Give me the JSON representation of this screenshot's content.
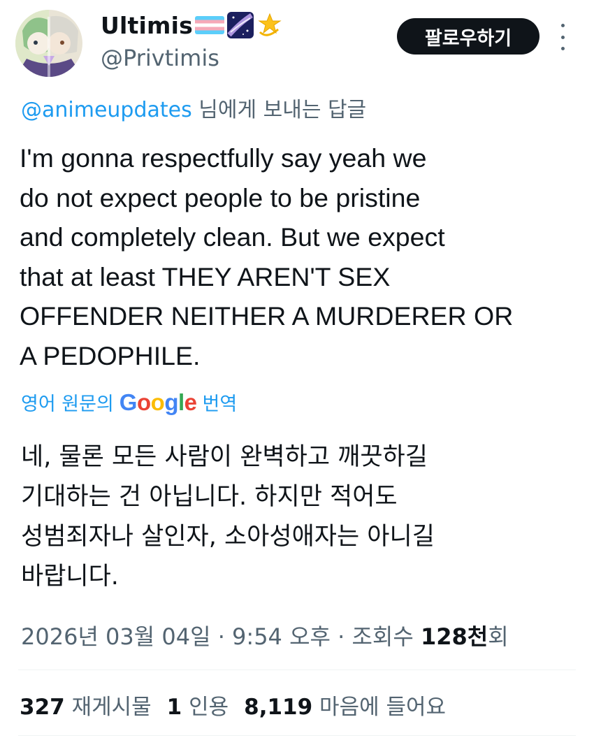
{
  "author": {
    "display_name": "Ultimis",
    "handle": "@Privtimis",
    "badges": [
      "transgender-flag-icon",
      "milky-way-icon",
      "dizzy-star-icon"
    ]
  },
  "follow_label": "팔로우하기",
  "more_icon": "more-vertical-icon",
  "reply_to": {
    "mention": "@animeupdates",
    "suffix": " 님에게 보내는 답글"
  },
  "tweet_lines": [
    "I'm gonna respectfully say yeah we",
    "do not expect people to be pristine",
    "and completely clean. But we expect",
    "that at least THEY AREN'T SEX",
    "OFFENDER NEITHER A MURDERER OR",
    "A PEDOPHILE."
  ],
  "translation": {
    "prefix": "영어 원문의",
    "provider": "Google",
    "suffix": "번역"
  },
  "translated_lines": [
    "네, 물론 모든 사람이 완벽하고 깨끗하길",
    "기대하는 건 아닙니다. 하지만 적어도",
    "성범죄자나 살인자, 소아성애자는 아니길",
    "바랍니다."
  ],
  "meta": {
    "timestamp": "2026년 03월 04일 · 9:54 오후 · 조회수 ",
    "views": "128천",
    "views_suffix": "회"
  },
  "stats": {
    "reposts_count": "327",
    "reposts_label": " 재게시물",
    "quotes_count": "1",
    "quotes_label": " 인용",
    "likes_count": "8,119",
    "likes_label": " 마음에 들어요"
  },
  "colors": {
    "accent": "#1d9bf0",
    "text": "#0f1419",
    "secondary": "#536471",
    "divider": "#eff3f4"
  }
}
